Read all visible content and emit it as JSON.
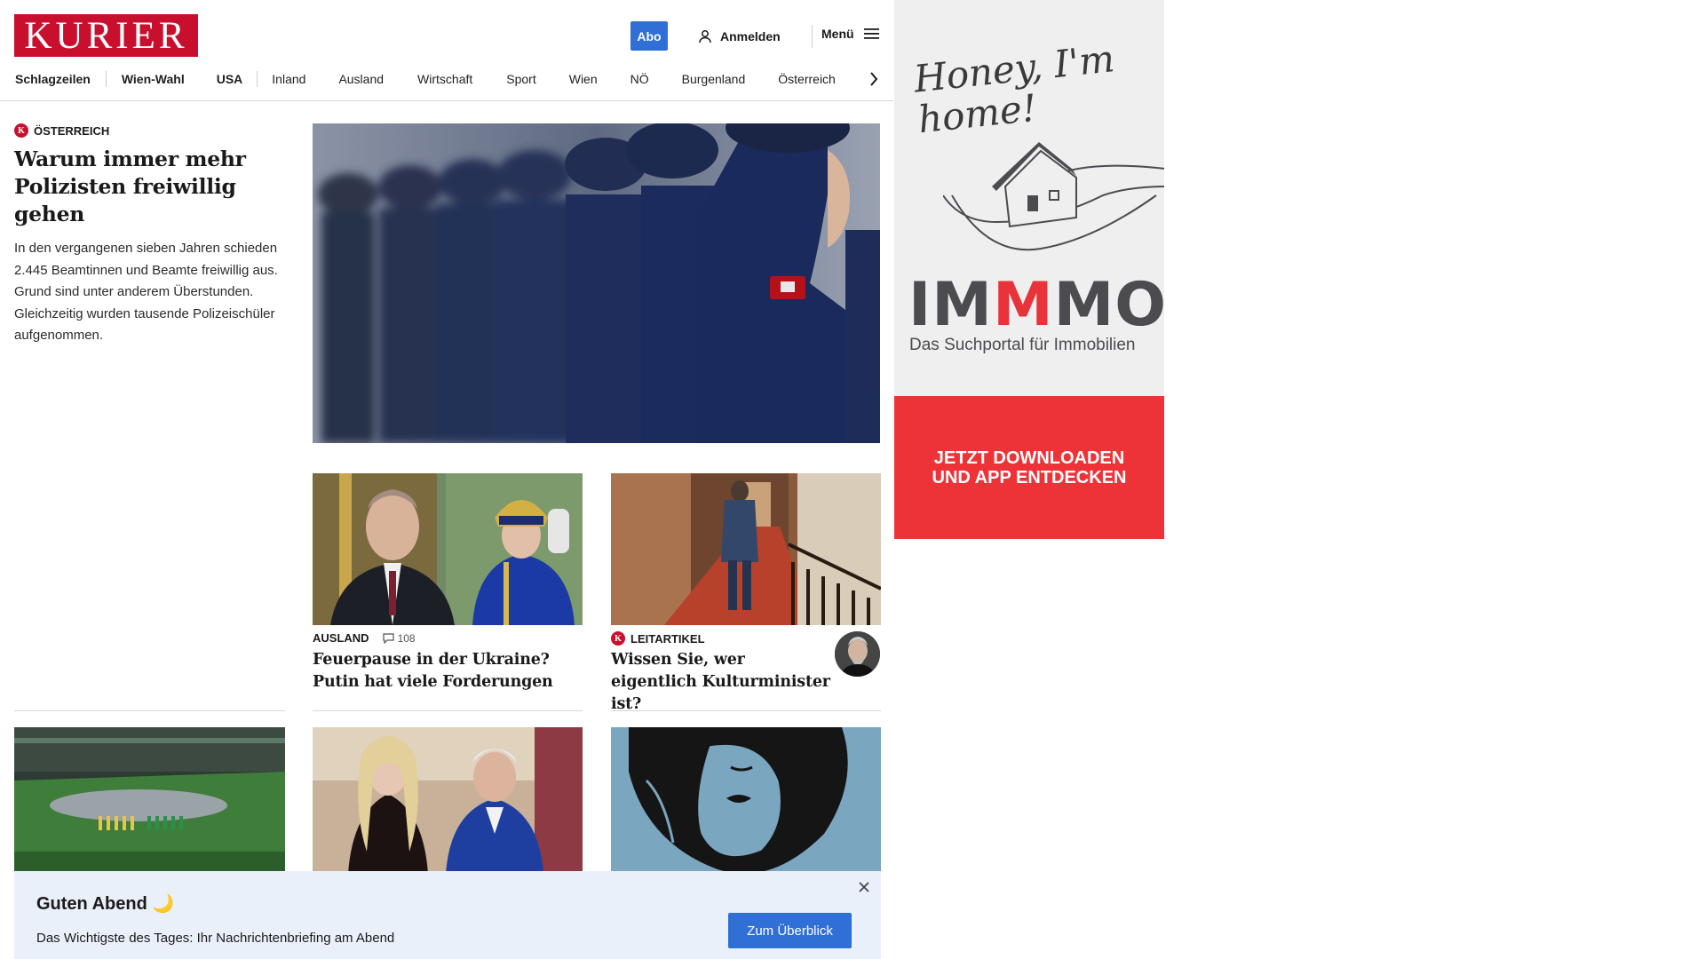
{
  "header": {
    "logo": "KURIER",
    "abo_label": "Abo",
    "login_label": "Anmelden",
    "menu_label": "Menü"
  },
  "nav": {
    "items": [
      "Schlagzeilen",
      "Wien-Wahl",
      "USA",
      "Inland",
      "Ausland",
      "Wirtschaft",
      "Sport",
      "Wien",
      "NÖ",
      "Burgenland",
      "Österreich"
    ]
  },
  "lead": {
    "kicker": "ÖSTERREICH",
    "title": "Warum immer mehr Polizisten freiwillig gehen",
    "teaser": "In den vergangenen sieben Jahren schieden 2.445 Beamtinnen und Beamte freiwillig aus. Grund sind unter anderem Überstunden. Gleichzeitig wurden tausende Polizeischüler aufgenommen."
  },
  "cards": [
    {
      "kicker": "AUSLAND",
      "comments": "108",
      "title": "Feuerpause in der Ukraine? Putin hat viele Forderungen"
    },
    {
      "kicker": "LEITARTIKEL",
      "title": "Wissen Sie, wer eigentlich Kulturminister ist?"
    }
  ],
  "ad": {
    "script": "Honey, I'm home!",
    "brand_a": "IM",
    "brand_b": "M",
    "brand_c": "MO",
    "tagline": "Das Suchportal für Immobilien",
    "cta_line1": "JETZT DOWNLOADEN",
    "cta_line2": "UND APP ENTDECKEN"
  },
  "banner": {
    "title": "Guten Abend 🌙",
    "text": "Das Wichtigste des Tages: Ihr Nachrichtenbriefing am Abend",
    "button": "Zum Überblick"
  },
  "colors": {
    "brand_red": "#c8102e",
    "accent_blue": "#2f6fd6",
    "ad_red": "#ee3338",
    "banner_bg": "#eaf0fa"
  }
}
